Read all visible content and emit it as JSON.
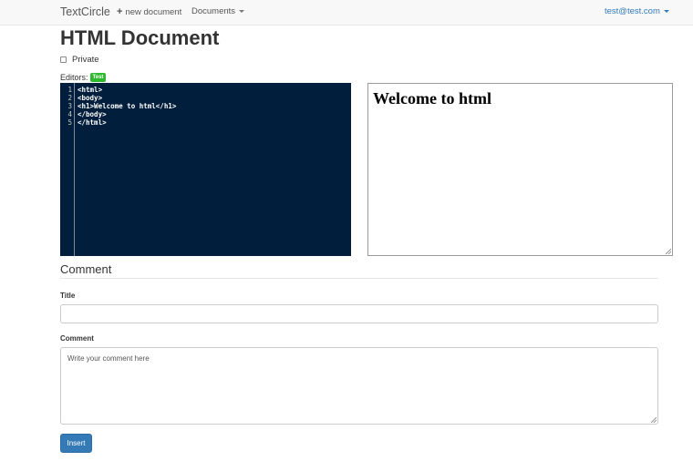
{
  "navbar": {
    "brand": "TextCircle",
    "new_document": "new document",
    "documents": "Documents",
    "user": "test@test.com"
  },
  "page": {
    "title": "HTML Document",
    "private_label": "Private",
    "editors_label": "Editors:",
    "editor_badge": "Test"
  },
  "editor": {
    "lines": [
      {
        "num": "1",
        "text": "<html>"
      },
      {
        "num": "2",
        "text": "<body>"
      },
      {
        "num": "3",
        "text": "<h1>Welcome to html</h1>"
      },
      {
        "num": "4",
        "text": "</body>"
      },
      {
        "num": "5",
        "text": "</html>"
      }
    ]
  },
  "preview": {
    "heading": "Welcome to html"
  },
  "comment_form": {
    "heading": "Comment",
    "title_label": "Title",
    "title_value": "",
    "comment_label": "Comment",
    "comment_placeholder": "Write your comment here",
    "submit_label": "Insert"
  },
  "colors": {
    "editor_bg": "#011e3c",
    "badge": "#2eb82e",
    "primary": "#337ab7"
  }
}
